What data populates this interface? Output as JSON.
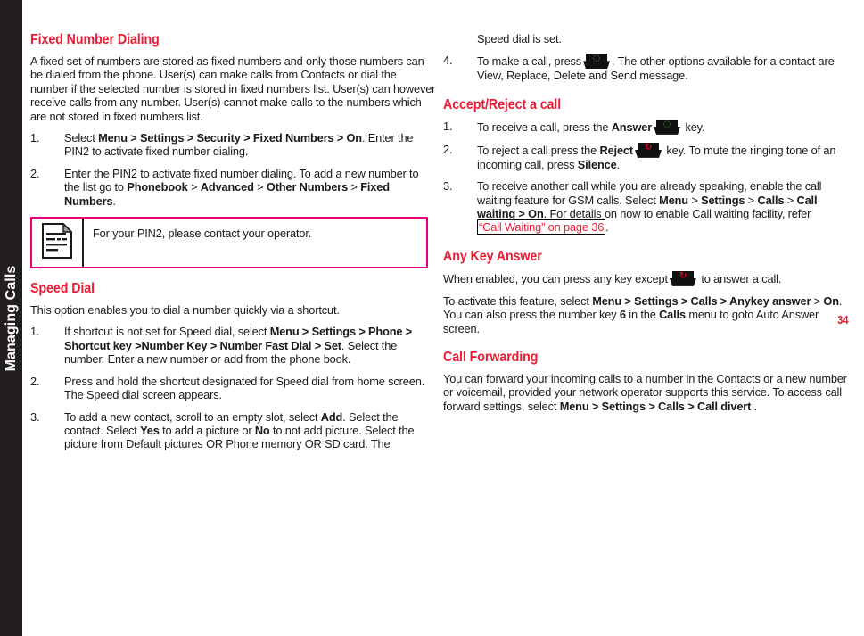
{
  "chapter_tab": {
    "label": "Managing Calls"
  },
  "folio": {
    "page_number": "34"
  },
  "colors": {
    "heading_red": "#ED1B34",
    "note_border_magenta": "#E6007E",
    "tab_black": "#231f20",
    "send_key_green": "#3FA535",
    "end_key_red": "#E4022A"
  },
  "left_column": {
    "section1": {
      "heading": "Fixed Number Dialing",
      "intro": "A fixed set of numbers are stored as fixed numbers and only those numbers can be dialed from the phone. User(s) can make calls from Contacts or dial the number if the selected number is stored in fixed numbers list. User(s) can however receive calls from any number. User(s) cannot make calls to the numbers which are not stored in fixed numbers list.",
      "steps": [
        {
          "num": "1.",
          "parts": [
            {
              "t": "Select ",
              "b": false
            },
            {
              "t": "Menu > Settings > Security > Fixed Numbers > On",
              "b": true
            },
            {
              "t": ". Enter the PIN2 to activate fixed number dialing.",
              "b": false
            }
          ]
        },
        {
          "num": "2.",
          "parts": [
            {
              "t": "Enter the PIN2 to activate fixed number dialing. To add a new number to the list go to ",
              "b": false
            },
            {
              "t": "Phonebook",
              "b": true
            },
            {
              "t": " > ",
              "b": false
            },
            {
              "t": "Advanced",
              "b": true
            },
            {
              "t": " > ",
              "b": false
            },
            {
              "t": "Other Numbers",
              "b": true
            },
            {
              "t": " > ",
              "b": false
            },
            {
              "t": "Fixed Numbers",
              "b": true
            },
            {
              "t": ".",
              "b": false
            }
          ]
        }
      ]
    },
    "note": {
      "icon": "document-note-icon",
      "text": "For your PIN2, please contact your operator."
    },
    "section2": {
      "heading": "Speed Dial",
      "intro": "This option enables you to dial a number quickly via a shortcut.",
      "steps": [
        {
          "num": "1.",
          "parts": [
            {
              "t": "If shortcut is not set for Speed dial, select ",
              "b": false
            },
            {
              "t": "Menu > Settings > Phone > Shortcut key >Number Key > Number Fast Dial > Set",
              "b": true
            },
            {
              "t": ". Select the number. Enter a new number or add from the phone book.",
              "b": false
            }
          ]
        },
        {
          "num": "2.",
          "parts": [
            {
              "t": "Press and hold the shortcut designated for Speed dial from home screen. The Speed dial screen appears.",
              "b": false
            }
          ]
        },
        {
          "num": "3.",
          "parts": [
            {
              "t": "To add a new contact, scroll to an empty slot, select ",
              "b": false
            },
            {
              "t": "Add",
              "b": true
            },
            {
              "t": ". Select the contact. Select ",
              "b": false
            },
            {
              "t": "Yes",
              "b": true
            },
            {
              "t": " to add a picture or ",
              "b": false
            },
            {
              "t": "No",
              "b": true
            },
            {
              "t": " to not add picture. Select the picture from Default pictures OR Phone memory OR SD card. The",
              "b": false
            }
          ]
        }
      ]
    }
  },
  "right_column": {
    "continued_text": "Speed dial is set.",
    "step4": {
      "num": "4.",
      "pre": "To make a call, press",
      "icon": "send-key-icon",
      "post": ". The other options available for a contact are View, Replace, Delete and Send message."
    },
    "section3": {
      "heading": "Accept/Reject a call",
      "steps": [
        {
          "num": "1.",
          "pre": "To receive a call, press the ",
          "bold1": "Answer",
          "icon": "send-key-icon",
          "post": " key."
        },
        {
          "num": "2.",
          "pre": "To reject a call press the ",
          "bold1": "Reject",
          "icon": "end-key-icon",
          "post_a": " key. To mute the ringing tone of an incoming call, press ",
          "bold2": "Silence",
          "post_b": "."
        },
        {
          "num": "3.",
          "parts": [
            {
              "t": "To receive another call while you are already speaking, enable the call waiting feature for GSM calls. Select ",
              "b": false
            },
            {
              "t": "Menu",
              "b": true
            },
            {
              "t": " > ",
              "b": false
            },
            {
              "t": "Settings",
              "b": true
            },
            {
              "t": " > ",
              "b": false
            },
            {
              "t": "Calls",
              "b": true
            },
            {
              "t": " > ",
              "b": false
            },
            {
              "t": "Call waiting > On",
              "b": true
            },
            {
              "t": ". For details on how to enable Call waiting facility, refer ",
              "b": false
            }
          ],
          "link_text": "“Call Waiting” on page 36",
          "tail": "."
        }
      ]
    },
    "section4": {
      "heading": "Any Key Answer",
      "para1_pre": "When enabled, you can press any key except",
      "para1_icon": "end-key-icon",
      "para1_post": " to answer a call.",
      "para2": [
        {
          "t": "To activate this feature, select ",
          "b": false
        },
        {
          "t": "Menu > Settings > Calls > Anykey answer",
          "b": true
        },
        {
          "t": " > ",
          "b": false
        },
        {
          "t": "On",
          "b": true
        },
        {
          "t": ". You can also press the number key ",
          "b": false
        },
        {
          "t": "6",
          "b": true
        },
        {
          "t": " in the ",
          "b": false
        },
        {
          "t": "Calls",
          "b": true
        },
        {
          "t": " menu to goto Auto Answer screen.",
          "b": false
        }
      ]
    },
    "section5": {
      "heading": "Call Forwarding",
      "para": [
        {
          "t": "You can forward your incoming calls to a number in the Contacts or a new number or voicemail, provided your network operator supports this service. To access call forward settings, select ",
          "b": false
        },
        {
          "t": "Menu > Settings > Calls > Call divert",
          "b": true
        },
        {
          "t": " .",
          "b": false
        }
      ]
    }
  }
}
